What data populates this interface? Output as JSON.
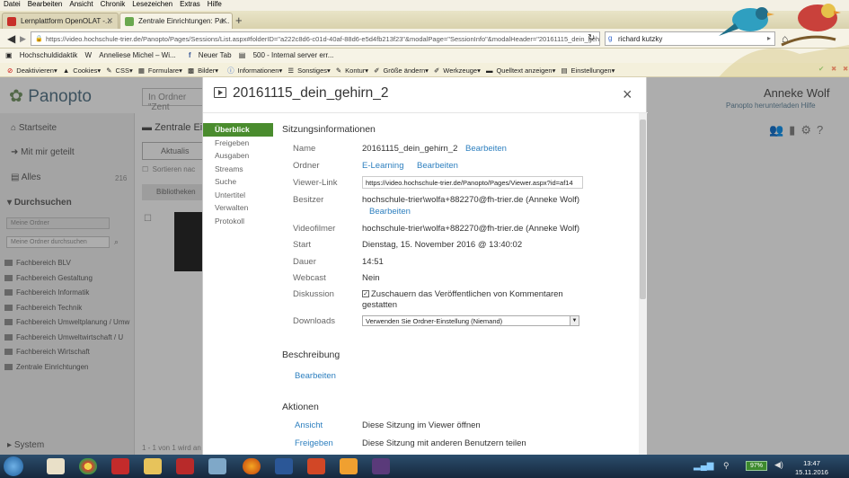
{
  "browser": {
    "menu": [
      "Datei",
      "Bearbeiten",
      "Ansicht",
      "Chronik",
      "Lesezeichen",
      "Extras",
      "Hilfe"
    ],
    "tabs": [
      {
        "label": "Lernplattform OpenOLAT -..."
      },
      {
        "label": "Zentrale Einrichtungen: Pa..."
      }
    ],
    "url": "https://video.hochschule-trier.de/Panopto/Pages/Sessions/List.aspx#folderID=\"a222c8d6-c01d-40af-88d6-e5d4fb213f23\"&modalPage=\"SessionInfo\"&modalHeader=\"20161115_dein_gehi",
    "search_value": "richard kutzky",
    "bookmarks": [
      "Hochschuldidaktik",
      "Anneliese Michel – Wi...",
      "Neuer Tab",
      "500 - Internal server err..."
    ],
    "devtools": [
      "Deaktivieren",
      "Cookies",
      "CSS",
      "Formulare",
      "Bilder",
      "Informationen",
      "Sonstiges",
      "Kontur",
      "Größe ändern",
      "Werkzeuge",
      "Quelltext anzeigen",
      "Einstellungen"
    ]
  },
  "panopto": {
    "logo": "Panopto",
    "search_placeholder": "In Ordner \"Zent",
    "user_name": "Anneke Wolf",
    "user_links": "Panopto herunterladen   Hilfe",
    "sidebar": {
      "home": "Startseite",
      "shared": "Mit mir geteilt",
      "all": "Alles",
      "all_count": "216",
      "browse": "Durchsuchen",
      "my_folder": "Meine Ordner",
      "folder_search_placeholder": "Meine Ordner durchsuchen",
      "folders": [
        "Fachbereich BLV",
        "Fachbereich Gestaltung",
        "Fachbereich Informatik",
        "Fachbereich Technik",
        "Fachbereich Umweltplanung / Umw",
        "Fachbereich Umweltwirtschaft / U",
        "Fachbereich Wirtschaft",
        "Zentrale Einrichtungen"
      ],
      "system": "System"
    },
    "breadcrumb": "Zentrale Ein",
    "toolbar_label": "Aktualis",
    "sort_label": "Sortieren nac",
    "library_label": "Bibliotheken",
    "pager": "1 - 1 von 1 wird an"
  },
  "modal": {
    "title": "20161115_dein_gehirn_2",
    "close": "×",
    "nav": [
      "Überblick",
      "Freigeben",
      "Ausgaben",
      "Streams",
      "Suche",
      "Untertitel",
      "Verwalten",
      "Protokoll"
    ],
    "session_info_heading": "Sitzungsinformationen",
    "fields": {
      "name_label": "Name",
      "name_value": "20161115_dein_gehirn_2",
      "edit": "Bearbeiten",
      "folder_label": "Ordner",
      "folder_value": "E-Learning",
      "viewer_label": "Viewer-Link",
      "viewer_value": "https://video.hochschule-trier.de/Panopto/Pages/Viewer.aspx?id=af14",
      "owner_label": "Besitzer",
      "owner_value": "hochschule-trier\\wolfa+882270@fh-trier.de (Anneke Wolf)",
      "videographer_label": "Videofilmer",
      "videographer_value": "hochschule-trier\\wolfa+882270@fh-trier.de (Anneke Wolf)",
      "start_label": "Start",
      "start_value": "Dienstag, 15. November 2016 @ 13:40:02",
      "duration_label": "Dauer",
      "duration_value": "14:51",
      "webcast_label": "Webcast",
      "webcast_value": "Nein",
      "discussion_label": "Diskussion",
      "discussion_value": "Zuschauern das Veröffentlichen von Kommentaren gestatten",
      "discussion_checked": true,
      "downloads_label": "Downloads",
      "downloads_value": "Verwenden Sie Ordner-Einstellung (Niemand)"
    },
    "description_heading": "Beschreibung",
    "description_edit": "Bearbeiten",
    "actions_heading": "Aktionen",
    "actions": [
      {
        "link": "Ansicht",
        "text": "Diese Sitzung im Viewer öffnen"
      },
      {
        "link": "Freigeben",
        "text": "Diese Sitzung mit anderen Benutzern teilen"
      }
    ]
  },
  "taskbar": {
    "battery": "97%",
    "time": "13:47",
    "date": "15.11.2016"
  }
}
